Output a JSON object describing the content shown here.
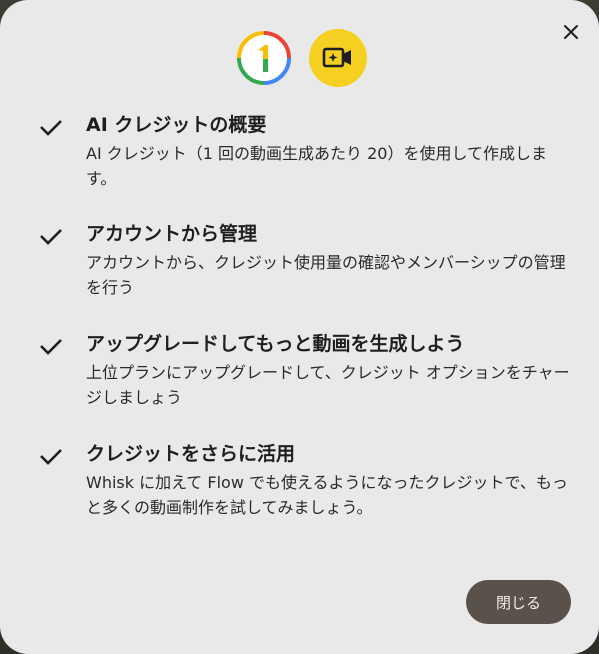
{
  "dialog": {
    "close_icon": "close-icon",
    "logos": {
      "one": "google-one-logo",
      "video": "video-spark-icon",
      "video_color": "#f5d020"
    },
    "features": [
      {
        "icon": "check-icon",
        "title": "AI クレジットの概要",
        "description": "AI クレジット（1 回の動画生成あたり 20）を使用して作成します。"
      },
      {
        "icon": "check-icon",
        "title": "アカウントから管理",
        "description": "アカウントから、クレジット使用量の確認やメンバーシップの管理を行う"
      },
      {
        "icon": "check-icon",
        "title": "アップグレードしてもっと動画を生成しよう",
        "description": "上位プランにアップグレードして、クレジット オプションをチャージしましょう"
      },
      {
        "icon": "check-icon",
        "title": "クレジットをさらに活用",
        "description": "Whisk に加えて Flow でも使えるようになったクレジットで、もっと多くの動画制作を試してみましょう。"
      }
    ],
    "close_button_label": "閉じる",
    "button_color": "#5a514a"
  }
}
